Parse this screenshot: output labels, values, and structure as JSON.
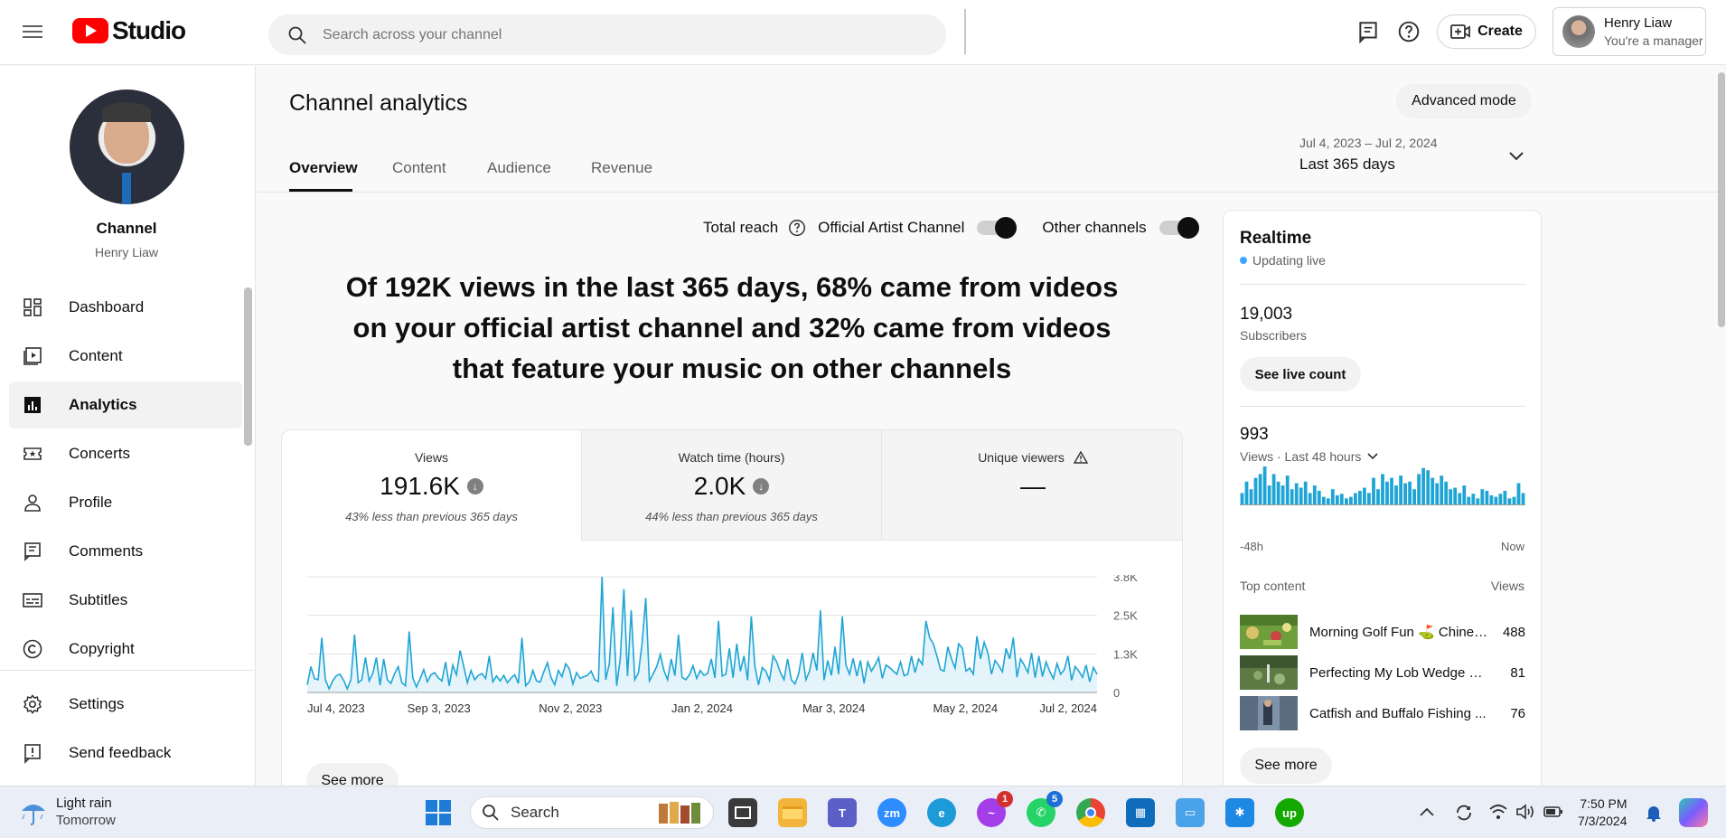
{
  "header": {
    "logo_text": "Studio",
    "search_placeholder": "Search across your channel",
    "create_label": "Create",
    "account_name": "Henry Liaw",
    "account_role": "You're a manager"
  },
  "sidebar": {
    "channel_title": "Channel",
    "channel_name": "Henry Liaw",
    "items": [
      {
        "label": "Dashboard",
        "icon": "dashboard-icon"
      },
      {
        "label": "Content",
        "icon": "content-icon"
      },
      {
        "label": "Analytics",
        "icon": "analytics-icon"
      },
      {
        "label": "Concerts",
        "icon": "ticket-icon"
      },
      {
        "label": "Profile",
        "icon": "person-icon"
      },
      {
        "label": "Comments",
        "icon": "comments-icon"
      },
      {
        "label": "Subtitles",
        "icon": "subtitles-icon"
      },
      {
        "label": "Copyright",
        "icon": "copyright-icon"
      },
      {
        "label": "Settings",
        "icon": "gear-icon"
      },
      {
        "label": "Send feedback",
        "icon": "feedback-icon"
      }
    ]
  },
  "main": {
    "title": "Channel analytics",
    "advanced_label": "Advanced mode",
    "tabs": [
      {
        "label": "Overview"
      },
      {
        "label": "Content"
      },
      {
        "label": "Audience"
      },
      {
        "label": "Revenue"
      }
    ],
    "date_range": {
      "dates": "Jul 4, 2023 – Jul 2, 2024",
      "label": "Last 365 days"
    },
    "reach": {
      "total_label": "Total reach",
      "official_label": "Official Artist Channel",
      "other_label": "Other channels"
    },
    "headline": "Of 192K views in the last 365 days, 68% came from videos on your official artist channel and 32% came from videos that feature your music on other channels",
    "metrics": [
      {
        "label": "Views",
        "value": "191.6K",
        "comparison": "43% less than previous 365 days"
      },
      {
        "label": "Watch time (hours)",
        "value": "2.0K",
        "comparison": "44% less than previous 365 days"
      },
      {
        "label": "Unique viewers",
        "value": "—",
        "comparison": ""
      }
    ],
    "see_more_label": "See more"
  },
  "chart_data": {
    "type": "area",
    "x_tick_labels": [
      "Jul 4, 2023",
      "Sep 3, 2023",
      "Nov 2, 2023",
      "Jan 2, 2024",
      "Mar 3, 2024",
      "May 2, 2024",
      "Jul 2, 2024"
    ],
    "y_tick_labels": [
      "3.8K",
      "2.5K",
      "1.3K",
      "0"
    ],
    "ylim": [
      0,
      3800
    ],
    "series": [
      {
        "color": "#1fa5d5",
        "values": [
          250,
          850,
          450,
          420,
          1800,
          420,
          120,
          380,
          550,
          600,
          400,
          120,
          420,
          1900,
          320,
          420,
          1150,
          380,
          620,
          1150,
          240,
          1100,
          420,
          300,
          620,
          850,
          320,
          220,
          2000,
          480,
          180,
          450,
          750,
          350,
          580,
          650,
          480,
          380,
          1000,
          220,
          900,
          580,
          1380,
          850,
          320,
          720,
          420,
          560,
          620,
          460,
          1200,
          350,
          540,
          380,
          560,
          320,
          470,
          580,
          300,
          1800,
          220,
          350,
          720,
          380,
          340,
          680,
          980,
          480,
          250,
          720,
          520,
          940,
          780,
          280,
          650,
          460,
          520,
          560,
          700,
          420,
          360,
          3800,
          420,
          950,
          2800,
          220,
          1100,
          3400,
          540,
          2700,
          420,
          650,
          1600,
          3100,
          380,
          600,
          850,
          1250,
          720,
          420,
          1100,
          550,
          1900,
          500,
          420,
          580,
          880,
          460,
          720,
          560,
          620,
          1100,
          480,
          2350,
          540,
          600,
          1450,
          480,
          1600,
          700,
          1200,
          400,
          2500,
          850,
          250,
          820,
          700,
          400,
          1200,
          1000,
          650,
          420,
          1100,
          420,
          280,
          600,
          1300,
          420,
          700,
          1300,
          720,
          2700,
          400,
          1050,
          560,
          1500,
          600,
          2500,
          900,
          600,
          1120,
          540,
          1050,
          300,
          1000,
          700,
          900,
          1150,
          460,
          900,
          820,
          700,
          600,
          1000,
          550,
          600,
          1200,
          650,
          1100,
          920,
          2350,
          1800,
          1600,
          1200,
          750,
          700,
          1500,
          1100,
          800,
          1600,
          1450,
          700,
          800,
          600,
          1850,
          1100,
          1650,
          1300,
          600,
          1050,
          880,
          680,
          1450,
          1100,
          1800,
          500,
          1100,
          900,
          650,
          1300,
          480,
          1200,
          520,
          1000,
          700,
          450,
          950,
          600,
          750,
          1200,
          400,
          850,
          700,
          500,
          900,
          350,
          820,
          600
        ]
      }
    ]
  },
  "realtime": {
    "title": "Realtime",
    "status": "Updating live",
    "subscribers": "19,003",
    "subscribers_label": "Subscribers",
    "live_count_label": "See live count",
    "views": "993",
    "views_label": "Views · Last 48 hours",
    "axis_start": "-48h",
    "axis_end": "Now",
    "bars": [
      15,
      30,
      20,
      35,
      40,
      50,
      25,
      40,
      30,
      25,
      38,
      20,
      28,
      22,
      30,
      15,
      25,
      18,
      10,
      8,
      20,
      12,
      14,
      8,
      10,
      15,
      18,
      22,
      15,
      35,
      20,
      40,
      30,
      35,
      25,
      38,
      28,
      30,
      20,
      40,
      48,
      45,
      35,
      28,
      38,
      30,
      20,
      22,
      15,
      25,
      10,
      14,
      8,
      20,
      18,
      12,
      10,
      14,
      18,
      8,
      10,
      28,
      15
    ],
    "top_content_label": "Top content",
    "views_col_label": "Views",
    "items": [
      {
        "title": "Morning Golf Fun ⛳ Chinese...",
        "views": "488"
      },
      {
        "title": "Perfecting My Lob Wedge Skills...",
        "views": "81"
      },
      {
        "title": "Catfish and Buffalo Fishing ...",
        "views": "76"
      }
    ],
    "see_more_label": "See more"
  },
  "taskbar": {
    "weather_title": "Light rain",
    "weather_sub": "Tomorrow",
    "search_label": "Search",
    "messenger_badge": "1",
    "whatsapp_badge": "5",
    "time": "7:50 PM",
    "date": "7/3/2024"
  }
}
